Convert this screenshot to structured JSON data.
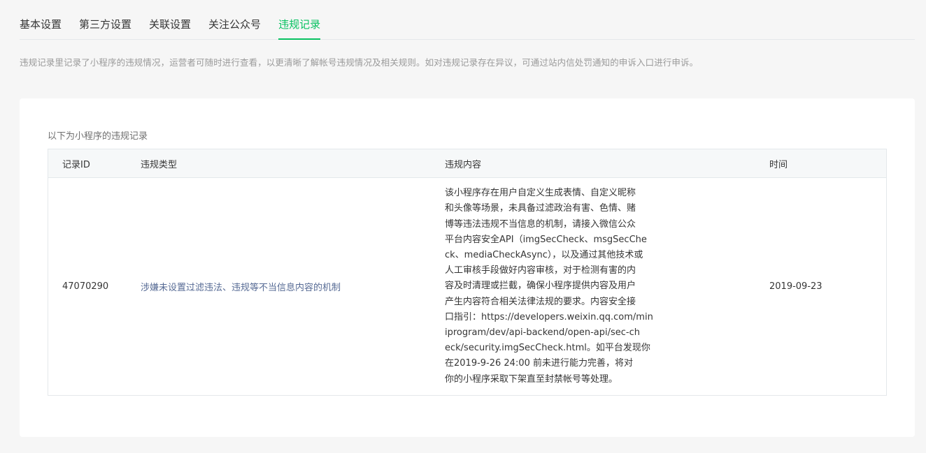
{
  "tabs": [
    {
      "label": "基本设置",
      "active": false
    },
    {
      "label": "第三方设置",
      "active": false
    },
    {
      "label": "关联设置",
      "active": false
    },
    {
      "label": "关注公众号",
      "active": false
    },
    {
      "label": "违规记录",
      "active": true
    }
  ],
  "description": "违规记录里记录了小程序的违规情况，运营者可随时进行查看，以更清晰了解帐号违规情况及相关规则。如对违规记录存在异议，可通过站内信处罚通知的申诉入口进行申诉。",
  "card": {
    "title": "以下为小程序的违规记录",
    "table": {
      "headers": [
        "记录ID",
        "违规类型",
        "违规内容",
        "时间"
      ],
      "rows": [
        {
          "id": "47070290",
          "type": "涉嫌未设置过滤违法、违规等不当信息内容的机制",
          "content": "该小程序存在用户自定义生成表情、自定义昵称\n和头像等场景，未具备过滤政治有害、色情、赌\n博等违法违规不当信息的机制，请接入微信公众\n平台内容安全API（imgSecCheck、msgSecChe\nck、mediaCheckAsync），以及通过其他技术或\n人工审核手段做好内容审核，对于检测有害的内\n容及时清理或拦截，确保小程序提供内容及用户\n产生内容符合相关法律法规的要求。内容安全接\n口指引：https://developers.weixin.qq.com/min\niprogram/dev/api-backend/open-api/sec-ch\neck/security.imgSecCheck.html。如平台发现你\n在2019-9-26 24:00 前未进行能力完善，将对\n你的小程序采取下架直至封禁帐号等处理。",
          "time": "2019-09-23"
        }
      ]
    }
  },
  "colors": {
    "accent": "#07c160",
    "link": "#576b95",
    "muted": "#9a9a9a",
    "background": "#f6f6f6"
  }
}
